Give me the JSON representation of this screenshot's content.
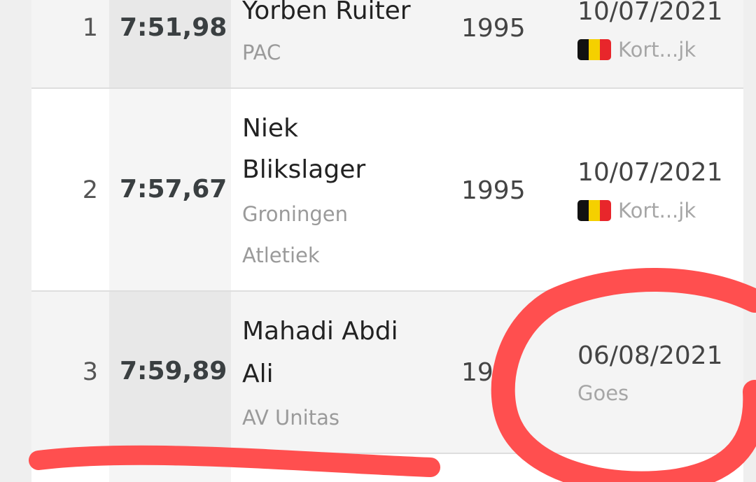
{
  "rows": [
    {
      "rank": "1",
      "performance": "7:51,98",
      "name_lines": [
        "Yorben Ruiter"
      ],
      "club_lines": [
        "PAC"
      ],
      "year": "1995",
      "date": "10/07/2021",
      "venue": "Kort...jk",
      "flag": "belgium-flag-icon"
    },
    {
      "rank": "2",
      "performance": "7:57,67",
      "name_lines": [
        "Niek",
        "Blikslager"
      ],
      "club_lines": [
        "Groningen",
        "Atletiek"
      ],
      "year": "1995",
      "date": "10/07/2021",
      "venue": "Kort...jk",
      "flag": "belgium-flag-icon"
    },
    {
      "rank": "3",
      "performance": "7:59,89",
      "name_lines": [
        "Mahadi Abdi",
        "Ali"
      ],
      "club_lines": [
        "AV Unitas"
      ],
      "year": "19",
      "date": "06/08/2021",
      "venue": "Goes"
    }
  ],
  "colors": {
    "flag_black": "#111111",
    "flag_yellow": "#f5d000",
    "flag_red": "#e8262b",
    "annotation_red": "#ff4f4f"
  }
}
